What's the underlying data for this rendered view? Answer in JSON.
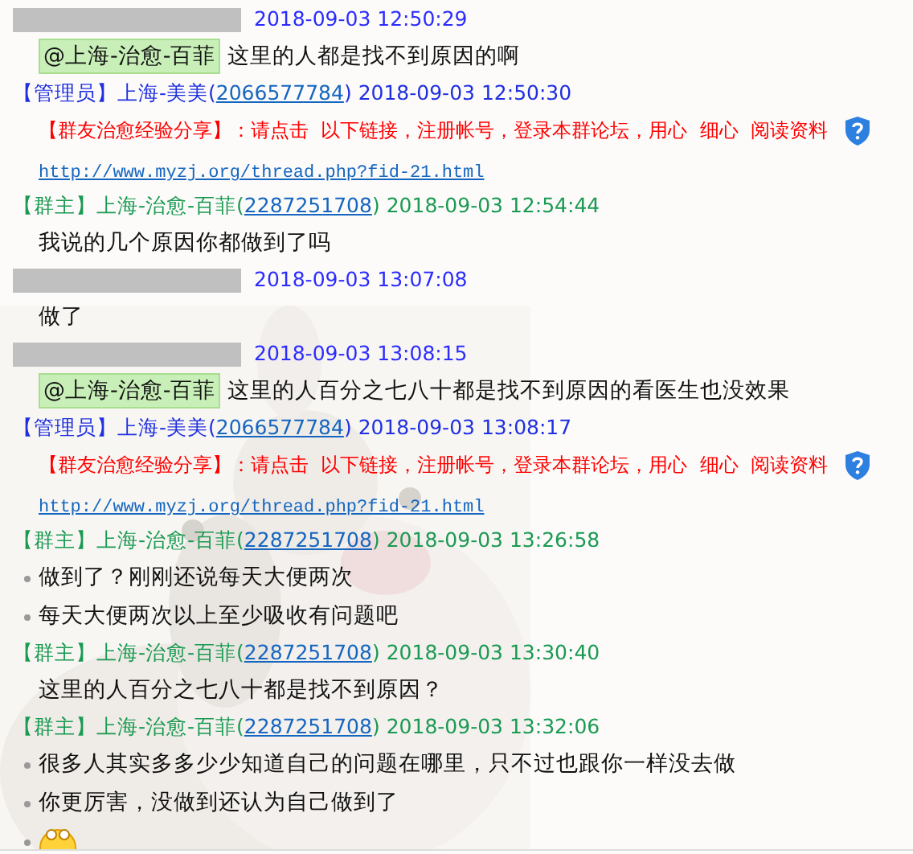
{
  "messages": [
    {
      "sender": {
        "kind": "hidden"
      },
      "time": "2018-09-03 12:50:29",
      "lines": [
        {
          "kind": "mention",
          "mention": "@上海-治愈-百菲",
          "text": "这里的人都是找不到原因的啊"
        }
      ]
    },
    {
      "sender": {
        "kind": "admin",
        "role": "【管理员】",
        "name": "上海-美美",
        "qq_open": "(",
        "qq": "2066577784",
        "qq_close": ")"
      },
      "time": "2018-09-03 12:50:30",
      "lines": [
        {
          "kind": "share",
          "text": "【群友治愈经验分享】：请点击  以下链接，注册帐号，登录本群论坛，用心  细心  阅读资料",
          "link": "http://www.myzj.org/thread.php?fid-21.html"
        }
      ]
    },
    {
      "sender": {
        "kind": "owner",
        "role": "【群主】",
        "name": "上海-治愈-百菲",
        "qq_open": "(",
        "qq": "2287251708",
        "qq_close": ")"
      },
      "time": "2018-09-03 12:54:44",
      "lines": [
        {
          "kind": "text",
          "bullet": false,
          "text": "我说的几个原因你都做到了吗"
        }
      ]
    },
    {
      "sender": {
        "kind": "hidden"
      },
      "time": "2018-09-03 13:07:08",
      "lines": [
        {
          "kind": "text",
          "bullet": false,
          "text": "做了"
        }
      ]
    },
    {
      "sender": {
        "kind": "hidden"
      },
      "time": "2018-09-03 13:08:15",
      "lines": [
        {
          "kind": "mention",
          "mention": "@上海-治愈-百菲",
          "text": "这里的人百分之七八十都是找不到原因的看医生也没效果"
        }
      ]
    },
    {
      "sender": {
        "kind": "admin",
        "role": "【管理员】",
        "name": "上海-美美",
        "qq_open": "(",
        "qq": "2066577784",
        "qq_close": ")"
      },
      "time": "2018-09-03 13:08:17",
      "lines": [
        {
          "kind": "share",
          "text": "【群友治愈经验分享】：请点击  以下链接，注册帐号，登录本群论坛，用心  细心  阅读资料",
          "link": "http://www.myzj.org/thread.php?fid-21.html"
        }
      ]
    },
    {
      "sender": {
        "kind": "owner",
        "role": "【群主】",
        "name": "上海-治愈-百菲",
        "qq_open": "(",
        "qq": "2287251708",
        "qq_close": ")"
      },
      "time": "2018-09-03 13:26:58",
      "lines": [
        {
          "kind": "text",
          "bullet": true,
          "text": "做到了？刚刚还说每天大便两次"
        },
        {
          "kind": "text",
          "bullet": true,
          "text": "每天大便两次以上至少吸收有问题吧"
        }
      ]
    },
    {
      "sender": {
        "kind": "owner",
        "role": "【群主】",
        "name": "上海-治愈-百菲",
        "qq_open": "(",
        "qq": "2287251708",
        "qq_close": ")"
      },
      "time": "2018-09-03 13:30:40",
      "lines": [
        {
          "kind": "text",
          "bullet": false,
          "text": "这里的人百分之七八十都是找不到原因？"
        }
      ]
    },
    {
      "sender": {
        "kind": "owner",
        "role": "【群主】",
        "name": "上海-治愈-百菲",
        "qq_open": "(",
        "qq": "2287251708",
        "qq_close": ")"
      },
      "time": "2018-09-03 13:32:06",
      "lines": [
        {
          "kind": "text",
          "bullet": true,
          "text": "很多人其实多多少少知道自己的问题在哪里，只不过也跟你一样没去做"
        },
        {
          "kind": "text",
          "bullet": true,
          "text": "你更厉害，没做到还认为自己做到了"
        },
        {
          "kind": "emoji",
          "bullet": true
        }
      ]
    }
  ]
}
